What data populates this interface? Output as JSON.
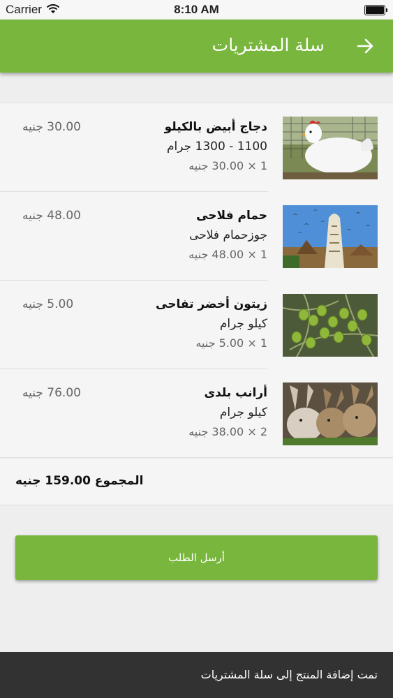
{
  "status_bar": {
    "carrier": "Carrier",
    "time": "8:10 AM"
  },
  "header": {
    "title": "سلة المشتريات",
    "back_icon": "arrow-right-icon"
  },
  "cart": {
    "items": [
      {
        "name": "دجاج أبيض بالكيلو",
        "description": "1100 - 1300 جرام",
        "quantity_line": "1 × 30.00 جنيه",
        "price": "30.00 جنيه",
        "image": "white-chicken-photo"
      },
      {
        "name": "حمام فلاحى",
        "description": "جوزحمام فلاحى",
        "quantity_line": "1 × 48.00 جنيه",
        "price": "48.00 جنيه",
        "image": "pigeon-tower-photo"
      },
      {
        "name": "زيتون أخضر تفاحى",
        "description": "كيلو جرام",
        "quantity_line": "1 × 5.00 جنيه",
        "price": "5.00 جنيه",
        "image": "green-olives-photo"
      },
      {
        "name": "أرانب بلدى",
        "description": "كيلو جرام",
        "quantity_line": "2 × 38.00 جنيه",
        "price": "76.00 جنيه",
        "image": "rabbits-photo"
      }
    ],
    "total": "المجموع 159.00 جنيه"
  },
  "send_button": {
    "label": "أرسل الطلب"
  },
  "toast": {
    "message": "تمت إضافة المنتج إلى سلة المشتريات"
  },
  "colors": {
    "accent": "#78b63d",
    "toast_bg": "#323232",
    "page_bg": "#eeeeee"
  }
}
